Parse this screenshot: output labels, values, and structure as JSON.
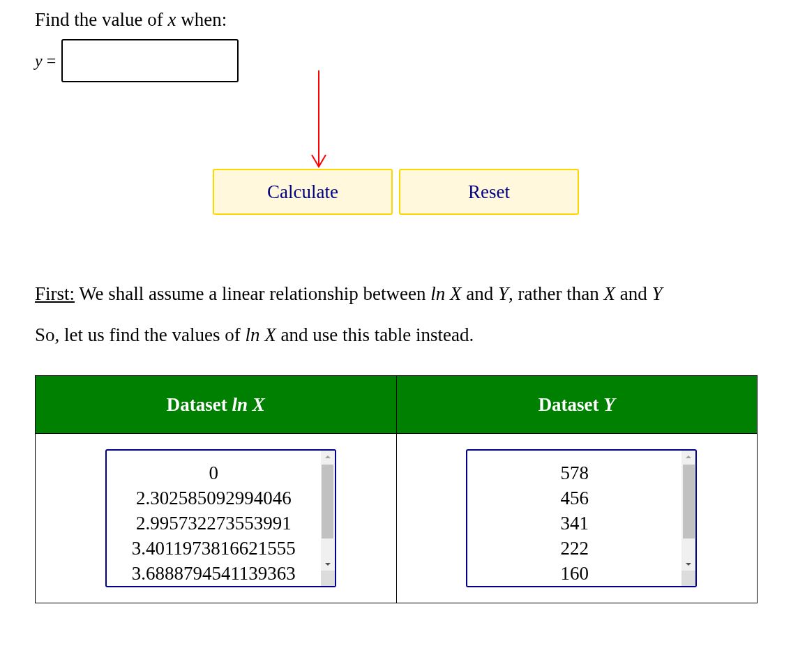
{
  "prompt": "Find the value of *x* when:",
  "input": {
    "label": "*y* ="
  },
  "buttons": [
    {
      "label": "Calculate"
    },
    {
      "label": "Reset"
    }
  ],
  "paragraphs": [
    {
      "lead": "First:",
      "text": "We shall assume a linear relationship between *ln X* and *Y*, rather than *X* and *Y*"
    },
    {
      "text": "So, let us find the values of *ln X* and use this table instead."
    }
  ],
  "table": {
    "columns": [
      "Dataset *ln X*",
      "Dataset *Y*"
    ],
    "cells": [
      {
        "values": [
          "0",
          "2.302585092994046",
          "2.995732273553991",
          "3.4011973816621555",
          "3.6888794541139363"
        ]
      },
      {
        "values": [
          "578",
          "456",
          "341",
          "222",
          "160"
        ]
      }
    ]
  }
}
